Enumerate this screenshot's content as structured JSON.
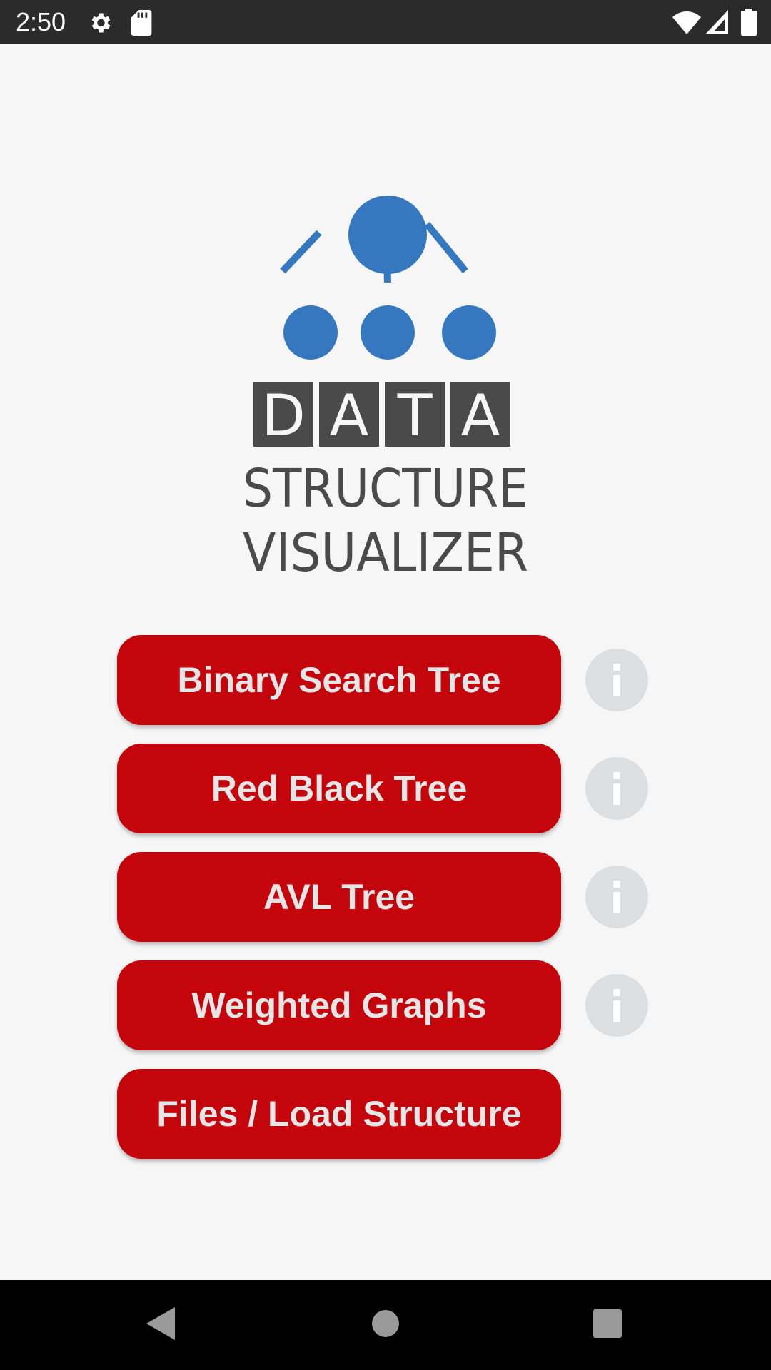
{
  "status_bar": {
    "time": "2:50",
    "icons": [
      "settings-icon",
      "sd-card-icon",
      "wifi-icon",
      "signal-icon",
      "battery-icon"
    ]
  },
  "logo": {
    "word_letters": [
      "D",
      "A",
      "T",
      "A"
    ],
    "line1": "STRUCTURE",
    "line2": "VISUALIZER",
    "accent_color": "#3678c0",
    "text_color": "#4a4a4a"
  },
  "menu": {
    "button_color": "#c4050c",
    "items": [
      {
        "label": "Binary Search Tree",
        "info_icon": "info-icon"
      },
      {
        "label": "Red Black Tree",
        "info_icon": "info-icon"
      },
      {
        "label": "AVL Tree",
        "info_icon": "info-icon"
      },
      {
        "label": "Weighted Graphs",
        "info_icon": "info-icon"
      },
      {
        "label": "Files / Load Structure"
      }
    ]
  },
  "nav_bar": {
    "buttons": [
      "back-icon",
      "home-icon",
      "recents-icon"
    ]
  }
}
